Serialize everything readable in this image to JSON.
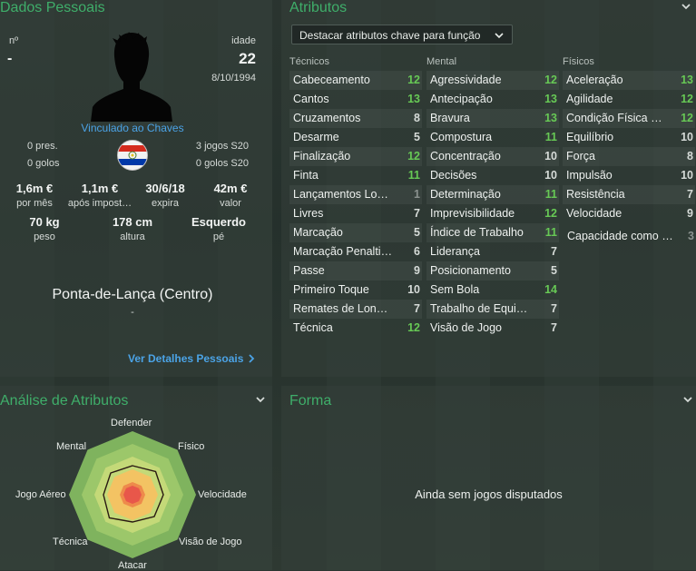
{
  "personal": {
    "title": "Dados Pessoais",
    "number_label": "nº",
    "number_value": "-",
    "age_label": "idade",
    "age_value": "22",
    "birth_date": "8/10/1994",
    "contract": "Vinculado ao Chaves",
    "pres": "0 pres.",
    "goals": "0 golos",
    "youth_games": "3 jogos S20",
    "youth_goals": "0 golos S20",
    "wage_value": "1,6m €",
    "wage_label": "por mês",
    "release_value": "1,1m €",
    "release_label": "após impost…",
    "expiry_value": "30/6/18",
    "expiry_label": "expira",
    "market_value": "42m €",
    "market_label": "valor",
    "weight_value": "70 kg",
    "weight_label": "peso",
    "height_value": "178 cm",
    "height_label": "altura",
    "foot_value": "Esquerdo",
    "foot_label": "pé",
    "position": "Ponta-de-Lança (Centro)",
    "position_sub": "-",
    "details_link": "Ver Detalhes Pessoais"
  },
  "attributes": {
    "title": "Atributos",
    "dropdown_label": "Destacar atributos chave para função",
    "tecnicos_header": "Técnicos",
    "mental_header": "Mental",
    "fisicos_header": "Físicos",
    "tecnicos": [
      {
        "name": "Cabeceamento",
        "value": "12"
      },
      {
        "name": "Cantos",
        "value": "13"
      },
      {
        "name": "Cruzamentos",
        "value": "8"
      },
      {
        "name": "Desarme",
        "value": "5"
      },
      {
        "name": "Finalização",
        "value": "12"
      },
      {
        "name": "Finta",
        "value": "11"
      },
      {
        "name": "Lançamentos Lo…",
        "value": "1"
      },
      {
        "name": "Livres",
        "value": "7"
      },
      {
        "name": "Marcação",
        "value": "5"
      },
      {
        "name": "Marcação Penalti…",
        "value": "6"
      },
      {
        "name": "Passe",
        "value": "9"
      },
      {
        "name": "Primeiro Toque",
        "value": "10"
      },
      {
        "name": "Remates de Lon…",
        "value": "7"
      },
      {
        "name": "Técnica",
        "value": "12"
      }
    ],
    "mental": [
      {
        "name": "Agressividade",
        "value": "12"
      },
      {
        "name": "Antecipação",
        "value": "13"
      },
      {
        "name": "Bravura",
        "value": "13"
      },
      {
        "name": "Compostura",
        "value": "11"
      },
      {
        "name": "Concentração",
        "value": "10"
      },
      {
        "name": "Decisões",
        "value": "10"
      },
      {
        "name": "Determinação",
        "value": "11"
      },
      {
        "name": "Imprevisibilidade",
        "value": "12"
      },
      {
        "name": "Índice de Trabalho",
        "value": "11"
      },
      {
        "name": "Liderança",
        "value": "7"
      },
      {
        "name": "Posicionamento",
        "value": "5"
      },
      {
        "name": "Sem Bola",
        "value": "14"
      },
      {
        "name": "Trabalho de Equi…",
        "value": "7"
      },
      {
        "name": "Visão de Jogo",
        "value": "7"
      }
    ],
    "fisicos": [
      {
        "name": "Aceleração",
        "value": "13"
      },
      {
        "name": "Agilidade",
        "value": "12"
      },
      {
        "name": "Condição Física …",
        "value": "12"
      },
      {
        "name": "Equilíbrio",
        "value": "10"
      },
      {
        "name": "Força",
        "value": "8"
      },
      {
        "name": "Impulsão",
        "value": "10"
      },
      {
        "name": "Resistência",
        "value": "7"
      },
      {
        "name": "Velocidade",
        "value": "9"
      }
    ],
    "ability": {
      "name": "Capacidade como …",
      "value": "3"
    }
  },
  "analysis": {
    "title": "Análise de Atributos",
    "labels": {
      "defender": "Defender",
      "fisico": "Físico",
      "velocidade": "Velocidade",
      "visao": "Visão de Jogo",
      "atacar": "Atacar",
      "tecnica": "Técnica",
      "aereo": "Jogo Aéreo",
      "mental": "Mental"
    }
  },
  "form": {
    "title": "Forma",
    "empty_text": "Ainda sem jogos disputados"
  },
  "colors": {
    "accent": "#3fae6a",
    "high": "#67c955",
    "link": "#4ba3e6"
  }
}
